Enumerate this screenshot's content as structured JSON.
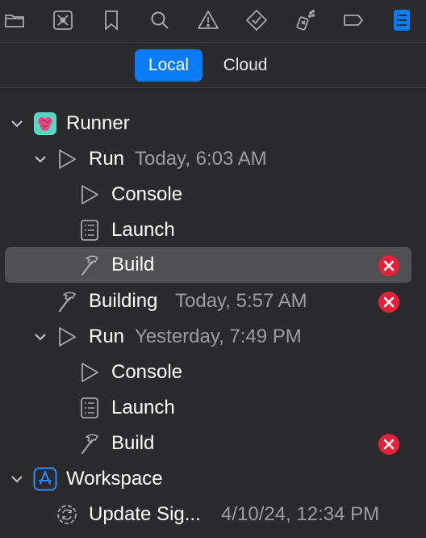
{
  "toolbar": {
    "icons": [
      "folder-icon",
      "issue-navigator-icon",
      "bookmark-icon",
      "search-icon",
      "warning-icon",
      "test-diamond-icon",
      "debug-spray-icon",
      "tag-icon",
      "report-navigator-icon"
    ]
  },
  "segments": {
    "local": "Local",
    "cloud": "Cloud"
  },
  "tree": {
    "runner": {
      "label": "Runner"
    },
    "run1": {
      "label": "Run",
      "time": "Today, 6:03 AM"
    },
    "console1": {
      "label": "Console"
    },
    "launch1": {
      "label": "Launch"
    },
    "build1": {
      "label": "Build"
    },
    "building": {
      "label": "Building",
      "time": "Today, 5:57 AM"
    },
    "run2": {
      "label": "Run",
      "time": "Yesterday, 7:49 PM"
    },
    "console2": {
      "label": "Console"
    },
    "launch2": {
      "label": "Launch"
    },
    "build2": {
      "label": "Build"
    },
    "workspace": {
      "label": "Workspace"
    },
    "update": {
      "label": "Update Sig...",
      "time": "4/10/24, 12:34 PM"
    }
  },
  "colors": {
    "accent": "#0a7cf5",
    "error": "#e5213a",
    "background": "#2b2b2d",
    "selected": "#505052"
  }
}
